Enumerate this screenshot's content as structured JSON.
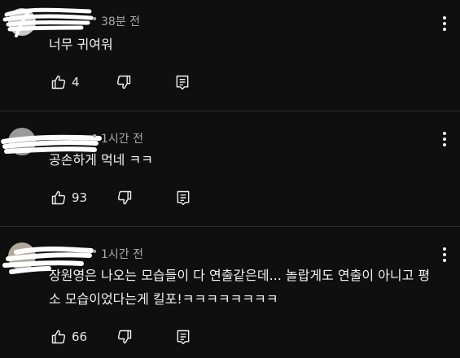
{
  "comments": [
    {
      "author": "",
      "time": "38분 전",
      "text": "너무 귀여워",
      "likes": "4",
      "avatar_color": "#c8c8c8"
    },
    {
      "author": "",
      "time": "1시간 전",
      "text": "공손하게 먹네 ㅋㅋ",
      "likes": "93",
      "avatar_color": "#9a9a9a"
    },
    {
      "author": "",
      "time": "1시간 전",
      "text": "장원영은 나오는 모습들이 다 연출같은데... 놀랍게도 연출이 아니고 평소 모습이었다는게 킬포!ㅋㅋㅋㅋㅋㅋㅋㅋ",
      "likes": "66",
      "avatar_color": "#b0a89a"
    }
  ],
  "icons": {
    "like": "thumb-up-icon",
    "dislike": "thumb-down-icon",
    "reply": "reply-icon",
    "more": "more-vertical-icon"
  },
  "colors": {
    "background": "#0f0f0f",
    "text": "#f1f1f1",
    "meta": "#aaaaaa",
    "divider": "#2f2f2f"
  }
}
